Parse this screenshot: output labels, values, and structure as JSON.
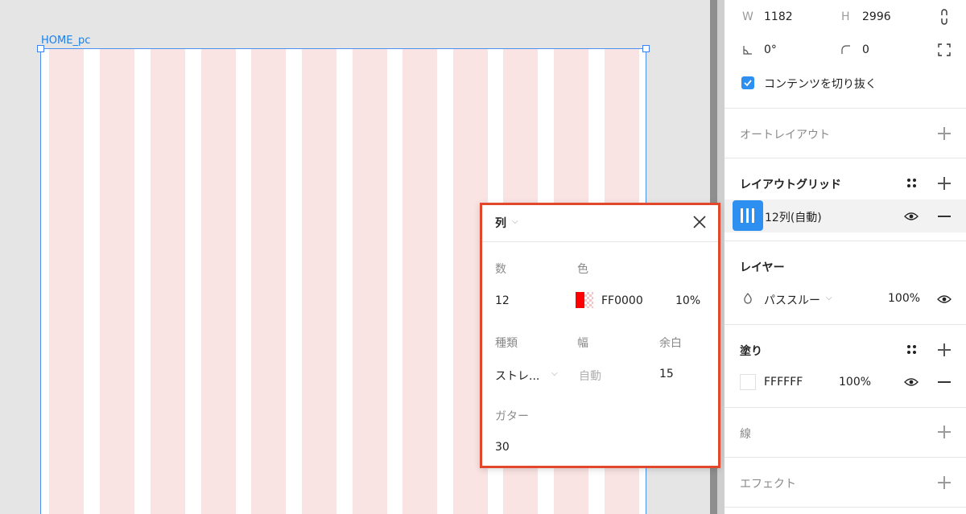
{
  "canvas": {
    "frame_label": "HOME_pc"
  },
  "popup": {
    "title": "列",
    "count_label": "数",
    "count_value": "12",
    "color_label": "色",
    "color_hex": "FF0000",
    "color_opacity": "10%",
    "type_label": "種類",
    "type_value": "ストレ...",
    "width_label": "幅",
    "width_value": "自動",
    "margin_label": "余白",
    "margin_value": "15",
    "gutter_label": "ガター",
    "gutter_value": "30",
    "swatch_color": "#FF0000"
  },
  "panel": {
    "w_label": "W",
    "w_value": "1182",
    "h_label": "H",
    "h_value": "2996",
    "rotation_value": "0°",
    "radius_value": "0",
    "clip_label": "コンテンツを切り抜く",
    "clip_checked": true,
    "auto_layout_title": "オートレイアウト",
    "layout_grid_title": "レイアウトグリッド",
    "layout_grid_item": "12列(自動)",
    "layer_title": "レイヤー",
    "blend_mode": "パススルー",
    "layer_opacity": "100%",
    "fill_title": "塗り",
    "fill_hex": "FFFFFF",
    "fill_opacity": "100%",
    "stroke_title": "線",
    "effect_title": "エフェクト"
  },
  "colors": {
    "accent": "#2D8FF0",
    "highlight_border": "#E2462B",
    "grid_column": "#F9E3E3"
  }
}
